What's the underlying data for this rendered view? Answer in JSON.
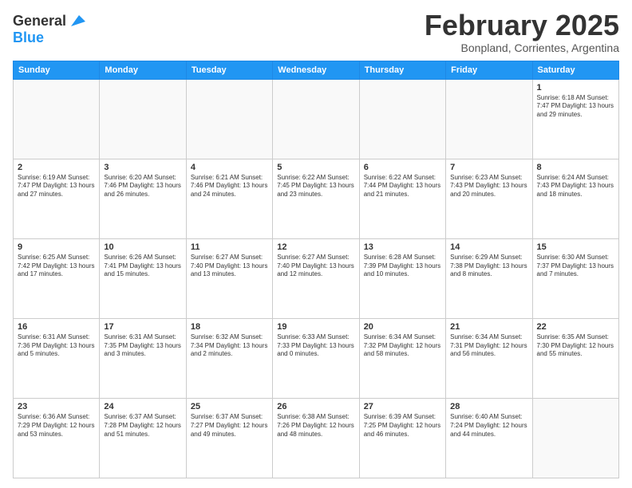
{
  "logo": {
    "line1": "General",
    "line2": "Blue"
  },
  "title": "February 2025",
  "subtitle": "Bonpland, Corrientes, Argentina",
  "headers": [
    "Sunday",
    "Monday",
    "Tuesday",
    "Wednesday",
    "Thursday",
    "Friday",
    "Saturday"
  ],
  "weeks": [
    [
      {
        "day": "",
        "info": ""
      },
      {
        "day": "",
        "info": ""
      },
      {
        "day": "",
        "info": ""
      },
      {
        "day": "",
        "info": ""
      },
      {
        "day": "",
        "info": ""
      },
      {
        "day": "",
        "info": ""
      },
      {
        "day": "1",
        "info": "Sunrise: 6:18 AM\nSunset: 7:47 PM\nDaylight: 13 hours\nand 29 minutes."
      }
    ],
    [
      {
        "day": "2",
        "info": "Sunrise: 6:19 AM\nSunset: 7:47 PM\nDaylight: 13 hours\nand 27 minutes."
      },
      {
        "day": "3",
        "info": "Sunrise: 6:20 AM\nSunset: 7:46 PM\nDaylight: 13 hours\nand 26 minutes."
      },
      {
        "day": "4",
        "info": "Sunrise: 6:21 AM\nSunset: 7:46 PM\nDaylight: 13 hours\nand 24 minutes."
      },
      {
        "day": "5",
        "info": "Sunrise: 6:22 AM\nSunset: 7:45 PM\nDaylight: 13 hours\nand 23 minutes."
      },
      {
        "day": "6",
        "info": "Sunrise: 6:22 AM\nSunset: 7:44 PM\nDaylight: 13 hours\nand 21 minutes."
      },
      {
        "day": "7",
        "info": "Sunrise: 6:23 AM\nSunset: 7:43 PM\nDaylight: 13 hours\nand 20 minutes."
      },
      {
        "day": "8",
        "info": "Sunrise: 6:24 AM\nSunset: 7:43 PM\nDaylight: 13 hours\nand 18 minutes."
      }
    ],
    [
      {
        "day": "9",
        "info": "Sunrise: 6:25 AM\nSunset: 7:42 PM\nDaylight: 13 hours\nand 17 minutes."
      },
      {
        "day": "10",
        "info": "Sunrise: 6:26 AM\nSunset: 7:41 PM\nDaylight: 13 hours\nand 15 minutes."
      },
      {
        "day": "11",
        "info": "Sunrise: 6:27 AM\nSunset: 7:40 PM\nDaylight: 13 hours\nand 13 minutes."
      },
      {
        "day": "12",
        "info": "Sunrise: 6:27 AM\nSunset: 7:40 PM\nDaylight: 13 hours\nand 12 minutes."
      },
      {
        "day": "13",
        "info": "Sunrise: 6:28 AM\nSunset: 7:39 PM\nDaylight: 13 hours\nand 10 minutes."
      },
      {
        "day": "14",
        "info": "Sunrise: 6:29 AM\nSunset: 7:38 PM\nDaylight: 13 hours\nand 8 minutes."
      },
      {
        "day": "15",
        "info": "Sunrise: 6:30 AM\nSunset: 7:37 PM\nDaylight: 13 hours\nand 7 minutes."
      }
    ],
    [
      {
        "day": "16",
        "info": "Sunrise: 6:31 AM\nSunset: 7:36 PM\nDaylight: 13 hours\nand 5 minutes."
      },
      {
        "day": "17",
        "info": "Sunrise: 6:31 AM\nSunset: 7:35 PM\nDaylight: 13 hours\nand 3 minutes."
      },
      {
        "day": "18",
        "info": "Sunrise: 6:32 AM\nSunset: 7:34 PM\nDaylight: 13 hours\nand 2 minutes."
      },
      {
        "day": "19",
        "info": "Sunrise: 6:33 AM\nSunset: 7:33 PM\nDaylight: 13 hours\nand 0 minutes."
      },
      {
        "day": "20",
        "info": "Sunrise: 6:34 AM\nSunset: 7:32 PM\nDaylight: 12 hours\nand 58 minutes."
      },
      {
        "day": "21",
        "info": "Sunrise: 6:34 AM\nSunset: 7:31 PM\nDaylight: 12 hours\nand 56 minutes."
      },
      {
        "day": "22",
        "info": "Sunrise: 6:35 AM\nSunset: 7:30 PM\nDaylight: 12 hours\nand 55 minutes."
      }
    ],
    [
      {
        "day": "23",
        "info": "Sunrise: 6:36 AM\nSunset: 7:29 PM\nDaylight: 12 hours\nand 53 minutes."
      },
      {
        "day": "24",
        "info": "Sunrise: 6:37 AM\nSunset: 7:28 PM\nDaylight: 12 hours\nand 51 minutes."
      },
      {
        "day": "25",
        "info": "Sunrise: 6:37 AM\nSunset: 7:27 PM\nDaylight: 12 hours\nand 49 minutes."
      },
      {
        "day": "26",
        "info": "Sunrise: 6:38 AM\nSunset: 7:26 PM\nDaylight: 12 hours\nand 48 minutes."
      },
      {
        "day": "27",
        "info": "Sunrise: 6:39 AM\nSunset: 7:25 PM\nDaylight: 12 hours\nand 46 minutes."
      },
      {
        "day": "28",
        "info": "Sunrise: 6:40 AM\nSunset: 7:24 PM\nDaylight: 12 hours\nand 44 minutes."
      },
      {
        "day": "",
        "info": ""
      }
    ]
  ]
}
